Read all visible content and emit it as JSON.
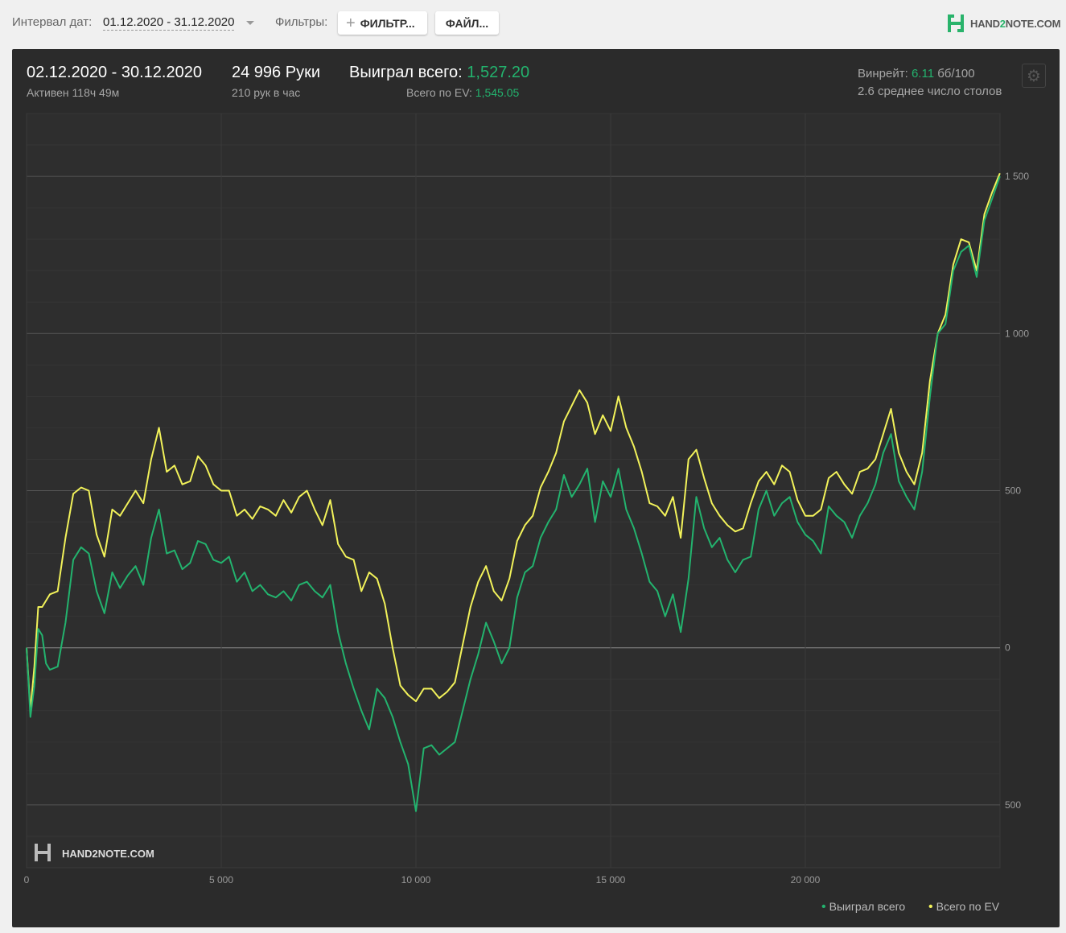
{
  "toolbar": {
    "date_label": "Интервал дат:",
    "date_value": "01.12.2020 - 31.12.2020",
    "filters_label": "Фильтры:",
    "filter_button": "ФИЛЬТР...",
    "file_button": "ФАЙЛ...",
    "logo_pre": "HAND",
    "logo_two": "2",
    "logo_post": "NOTE.COM"
  },
  "summary": {
    "period": "02.12.2020 - 30.12.2020",
    "active": "Активен 118ч 49м",
    "hands": "24 996 Руки",
    "hands_per_hour": "210 рук в час",
    "won_label": "Выиграл всего:",
    "won_value": "1,527.20",
    "ev_label": "Всего по EV:",
    "ev_value": "1,545.05",
    "winrate_label": "Винрейт:",
    "winrate_value": "6.11",
    "winrate_unit": "бб/100",
    "avg_tables": "2.6 среднее число столов"
  },
  "chart_data": {
    "type": "line",
    "x_ticks": [
      "0",
      "5 000",
      "10 000",
      "15 000",
      "20 000"
    ],
    "y_ticks": [
      "1 500",
      "1 000",
      "500",
      "0",
      "500"
    ],
    "xlim": [
      0,
      25000
    ],
    "ylim": [
      -700,
      1700
    ],
    "grid": true,
    "legend_position": "bottom-right",
    "watermark": "HAND2NOTE.COM",
    "x": [
      0,
      100,
      200,
      300,
      400,
      500,
      600,
      800,
      1000,
      1200,
      1400,
      1600,
      1800,
      2000,
      2200,
      2400,
      2600,
      2800,
      3000,
      3200,
      3400,
      3600,
      3800,
      4000,
      4200,
      4400,
      4600,
      4800,
      5000,
      5200,
      5400,
      5600,
      5800,
      6000,
      6200,
      6400,
      6600,
      6800,
      7000,
      7200,
      7400,
      7600,
      7800,
      8000,
      8200,
      8400,
      8600,
      8800,
      9000,
      9200,
      9400,
      9600,
      9800,
      10000,
      10200,
      10400,
      10600,
      10800,
      11000,
      11200,
      11400,
      11600,
      11800,
      12000,
      12200,
      12400,
      12600,
      12800,
      13000,
      13200,
      13400,
      13600,
      13800,
      14000,
      14200,
      14400,
      14600,
      14800,
      15000,
      15200,
      15400,
      15600,
      15800,
      16000,
      16200,
      16400,
      16600,
      16800,
      17000,
      17200,
      17400,
      17600,
      17800,
      18000,
      18200,
      18400,
      18600,
      18800,
      19000,
      19200,
      19400,
      19600,
      19800,
      20000,
      20200,
      20400,
      20600,
      20800,
      21000,
      21200,
      21400,
      21600,
      21800,
      22000,
      22200,
      22400,
      22600,
      22800,
      23000,
      23200,
      23400,
      23600,
      23800,
      24000,
      24200,
      24400,
      24600,
      24800,
      24996
    ],
    "series": [
      {
        "name": "Выиграл всего",
        "color": "#23b36e",
        "values": [
          0,
          -220,
          -120,
          60,
          40,
          -50,
          -70,
          -60,
          80,
          280,
          320,
          300,
          180,
          110,
          240,
          190,
          230,
          260,
          200,
          350,
          440,
          300,
          310,
          250,
          270,
          340,
          330,
          280,
          270,
          290,
          210,
          240,
          180,
          200,
          170,
          160,
          180,
          150,
          200,
          210,
          180,
          160,
          200,
          50,
          -50,
          -130,
          -200,
          -260,
          -130,
          -160,
          -220,
          -300,
          -370,
          -520,
          -320,
          -310,
          -340,
          -320,
          -300,
          -200,
          -100,
          -20,
          80,
          20,
          -50,
          0,
          160,
          240,
          260,
          350,
          400,
          440,
          550,
          480,
          520,
          570,
          400,
          530,
          480,
          570,
          440,
          380,
          300,
          210,
          180,
          100,
          170,
          50,
          220,
          480,
          380,
          320,
          350,
          280,
          240,
          280,
          290,
          440,
          500,
          420,
          460,
          480,
          400,
          360,
          340,
          300,
          450,
          420,
          400,
          350,
          420,
          460,
          520,
          620,
          680,
          530,
          480,
          440,
          560,
          800,
          1000,
          1030,
          1200,
          1260,
          1280,
          1180,
          1360,
          1430,
          1500,
          1527
        ]
      },
      {
        "name": "Всего по EV",
        "color": "#f2f25a",
        "values": [
          0,
          -200,
          -60,
          130,
          130,
          150,
          170,
          180,
          350,
          490,
          510,
          500,
          360,
          290,
          440,
          420,
          460,
          500,
          460,
          600,
          700,
          560,
          580,
          520,
          530,
          610,
          580,
          520,
          500,
          500,
          420,
          440,
          410,
          450,
          440,
          420,
          470,
          430,
          480,
          500,
          440,
          390,
          470,
          330,
          290,
          280,
          180,
          240,
          220,
          140,
          0,
          -120,
          -150,
          -170,
          -130,
          -130,
          -160,
          -140,
          -110,
          10,
          130,
          210,
          260,
          180,
          150,
          220,
          340,
          390,
          420,
          510,
          560,
          620,
          720,
          770,
          820,
          780,
          680,
          740,
          690,
          800,
          700,
          640,
          560,
          460,
          450,
          420,
          480,
          350,
          600,
          630,
          540,
          460,
          420,
          390,
          370,
          380,
          460,
          530,
          560,
          520,
          580,
          560,
          470,
          420,
          420,
          440,
          540,
          560,
          520,
          490,
          560,
          570,
          600,
          680,
          760,
          620,
          560,
          520,
          620,
          850,
          1000,
          1060,
          1220,
          1300,
          1290,
          1200,
          1380,
          1450,
          1510,
          1545
        ]
      }
    ]
  }
}
